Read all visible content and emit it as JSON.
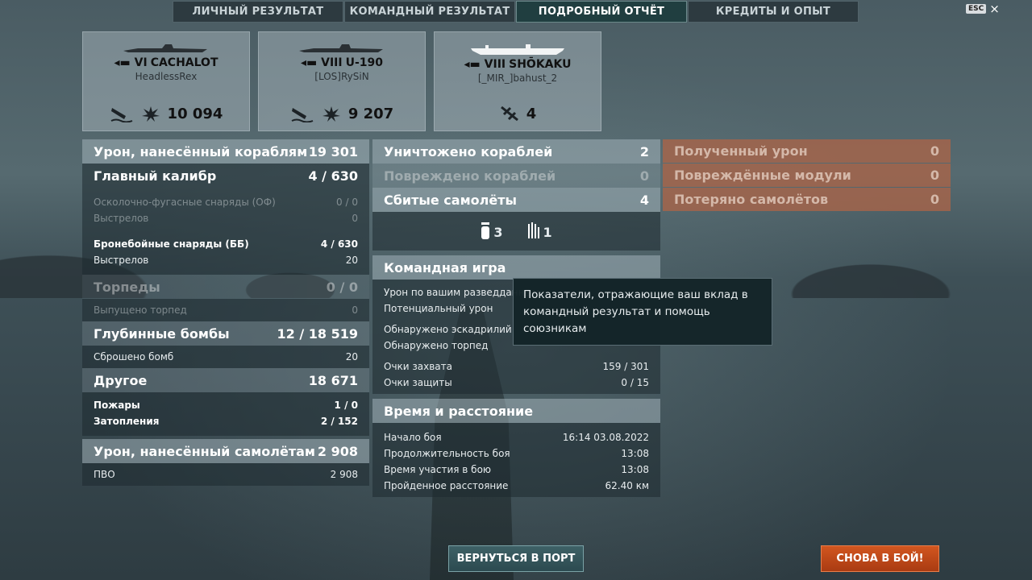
{
  "tabs": [
    {
      "label": "ЛИЧНЫЙ РЕЗУЛЬТАТ"
    },
    {
      "label": "КОМАНДНЫЙ РЕЗУЛЬТАТ"
    },
    {
      "label": "ПОДРОБНЫЙ ОТЧЁТ"
    },
    {
      "label": "КРЕДИТЫ И ОПЫТ"
    }
  ],
  "esc_label": "ESC",
  "close_glyph": "×",
  "cards": [
    {
      "tier": "VI",
      "ship": "CACHALOT",
      "player": "HeadlessRex",
      "value": "10 094"
    },
    {
      "tier": "VIII",
      "ship": "U-190",
      "player": "[LOS]RySiN",
      "value": "9 207"
    },
    {
      "tier": "VIII",
      "ship": "SHŌKAKU",
      "player": "[_MIR_]bahust_2",
      "value": "4"
    }
  ],
  "left": {
    "damage_head": {
      "label": "Урон, нанесённый кораблям",
      "value": "19 301"
    },
    "main_battery": {
      "label": "Главный калибр",
      "shots": "4",
      "value": "630"
    },
    "he_shells": {
      "label": "Осколочно-фугасные снаряды (ОФ)",
      "value": "0 / 0"
    },
    "he_shots": {
      "label": "Выстрелов",
      "value": "0"
    },
    "ap_shells": {
      "label": "Бронебойные снаряды (ББ)",
      "shots": "4",
      "value": "630"
    },
    "ap_shots": {
      "label": "Выстрелов",
      "value": "20"
    },
    "torpedoes": {
      "label": "Торпеды",
      "value": "0 / 0"
    },
    "torp_fired": {
      "label": "Выпущено торпед",
      "value": "0"
    },
    "depth_charges": {
      "label": "Глубинные бомбы",
      "shots": "12",
      "value": "18 519"
    },
    "bombs_dropped": {
      "label": "Сброшено бомб",
      "value": "20"
    },
    "other": {
      "label": "Другое",
      "value": "18 671"
    },
    "fires": {
      "label": "Пожары",
      "shots": "1",
      "value": "0"
    },
    "floods": {
      "label": "Затопления",
      "shots": "2",
      "value": "152"
    },
    "plane_damage": {
      "label": "Урон, нанесённый самолётам",
      "value": "2 908"
    },
    "aa": {
      "label": "ПВО",
      "value": "2 908"
    }
  },
  "middle": {
    "destroyed": {
      "label": "Уничтожено кораблей",
      "value": "2"
    },
    "damaged": {
      "label": "Повреждено кораблей",
      "value": "0"
    },
    "planes_shot": {
      "label": "Сбитые самолёты",
      "value": "4"
    },
    "plane_types": [
      {
        "value": "3"
      },
      {
        "value": "1"
      }
    ],
    "team_play": {
      "title": "Командная игра",
      "spotting_damage": "Урон по вашим разведданным",
      "potential_damage": "Потенциальный урон",
      "squadrons_spotted": "Обнаружено эскадрилий",
      "torps_spotted": "Обнаружено торпед",
      "capture": {
        "label": "Очки захвата",
        "value": "159 / 301"
      },
      "defense": {
        "label": "Очки защиты",
        "value": "0 / 15"
      }
    },
    "time": {
      "title": "Время и расстояние",
      "start": {
        "label": "Начало боя",
        "value": "16:14  03.08.2022"
      },
      "duration": {
        "label": "Продолжительность боя",
        "value": "13:08"
      },
      "participation": {
        "label": "Время участия в бою",
        "value": "13:08"
      },
      "distance": {
        "label": "Пройденное расстояние",
        "value": "62.40 км"
      }
    }
  },
  "right": {
    "received": {
      "label": "Полученный урон",
      "value": "0"
    },
    "modules": {
      "label": "Повреждённые модули",
      "value": "0"
    },
    "planes_lost": {
      "label": "Потеряно самолётов",
      "value": "0"
    }
  },
  "tooltip": "Показатели, отражающие ваш вклад в командный результат и помощь союзникам",
  "buttons": {
    "port": "ВЕРНУТЬСЯ В ПОРТ",
    "battle": "СНОВА В БОЙ!"
  },
  "colors": {
    "accent_orange": "#c34a17",
    "received_panel": "#aa6448",
    "tab_active": "#1e3c3e"
  }
}
